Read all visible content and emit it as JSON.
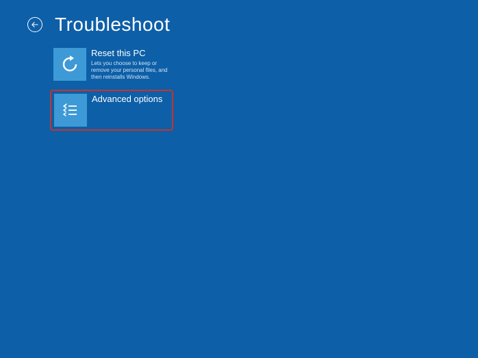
{
  "header": {
    "title": "Troubleshoot"
  },
  "options": {
    "reset": {
      "title": "Reset this PC",
      "desc": "Lets you choose to keep or remove your personal files, and then reinstalls Windows."
    },
    "advanced": {
      "title": "Advanced options",
      "desc": ""
    }
  }
}
